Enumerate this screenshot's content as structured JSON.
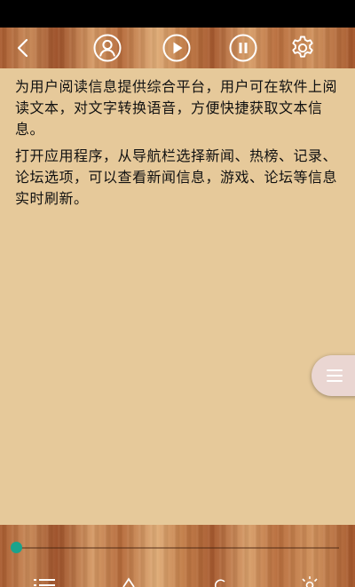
{
  "toolbar": {
    "back_icon": "chevron-left-icon",
    "user_icon": "user-circle-icon",
    "play_icon": "play-circle-icon",
    "pause_icon": "pause-circle-icon",
    "settings_icon": "gear-icon"
  },
  "content": {
    "paragraphs": [
      "为用户阅读信息提供综合平台，用户可在软件上阅读文本，对文字转换语音，方便快捷获取文本信息。",
      "打开应用程序，从导航栏选择新闻、热榜、记录、论坛选项，可以查看新闻信息，游戏、论坛等信息实时刷新。"
    ]
  },
  "floating_menu": {
    "icon": "menu-icon"
  },
  "reader_progress": {
    "value": 0.0
  },
  "colors": {
    "page_background": "#e6c99a",
    "progress_thumb": "#1aa38c",
    "fab_background": "#ead6d2"
  }
}
